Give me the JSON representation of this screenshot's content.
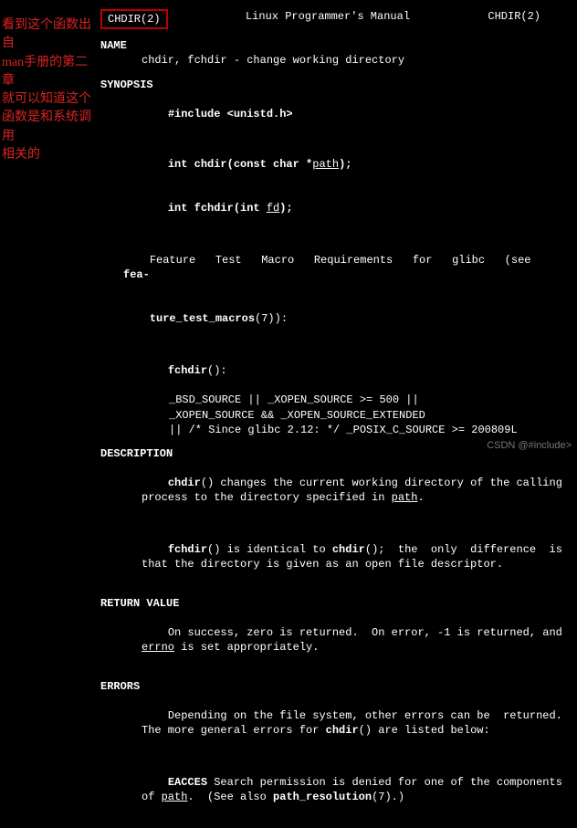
{
  "header": {
    "left": "CHDIR(2)",
    "center": "Linux Programmer's Manual",
    "right": "CHDIR(2)"
  },
  "annotation": {
    "l1": "看到这个函数出自",
    "l2": "man手册的第二章",
    "l3": "就可以知道这个",
    "l4": "函数是和系统调用",
    "l5": "相关的"
  },
  "name": {
    "head": "NAME",
    "text": "chdir, fchdir - change working directory"
  },
  "synopsis": {
    "head": "SYNOPSIS",
    "include_pre": "#include ",
    "include_hdr": "<unistd.h>",
    "proto1_pre": "int chdir(const char *",
    "proto1_arg": "path",
    "proto1_post": ");",
    "proto2_pre": "int fchdir(int ",
    "proto2_arg": "fd",
    "proto2_post": ");",
    "ftm1a": "Feature   Test   Macro   Requirements   for   glibc   (see  ",
    "ftm1b": "fea-",
    "ftm2": "ture_test_macros",
    "ftm2b": "(7)):",
    "fchdir_label": "fchdir",
    "fchdir_label2": "():",
    "macro1": "_BSD_SOURCE || _XOPEN_SOURCE >= 500 ||",
    "macro2": "_XOPEN_SOURCE && _XOPEN_SOURCE_EXTENDED",
    "macro3": "|| /* Since glibc 2.12: */ _POSIX_C_SOURCE >= 200809L"
  },
  "description": {
    "head": "DESCRIPTION",
    "p1a": "chdir",
    "p1b": "() changes the current working directory of the calling process to the directory specified in ",
    "p1c": "path",
    "p1d": ".",
    "p2a": "fchdir",
    "p2b": "() is identical to ",
    "p2c": "chdir",
    "p2d": "();  the  only  difference  is that the directory is given as an open file descriptor."
  },
  "retval": {
    "head": "RETURN VALUE",
    "t1": "On success, zero is returned.  On error, -1 is returned, and ",
    "t2": "errno",
    "t3": " is set appropriately."
  },
  "errors": {
    "head": "ERRORS",
    "t1": "Depending on the file system, other errors can be  returned. The more general errors for ",
    "t2": "chdir",
    "t3": "() are listed below:",
    "eacces_lbl": "EACCES",
    "eacces_1": " Search permission is denied for one of the components of ",
    "eacces_2": "path",
    "eacces_3": ".  (See also ",
    "eacces_4": "path_resolution",
    "eacces_5": "(7).)"
  },
  "watermark": "CSDN @#include>"
}
